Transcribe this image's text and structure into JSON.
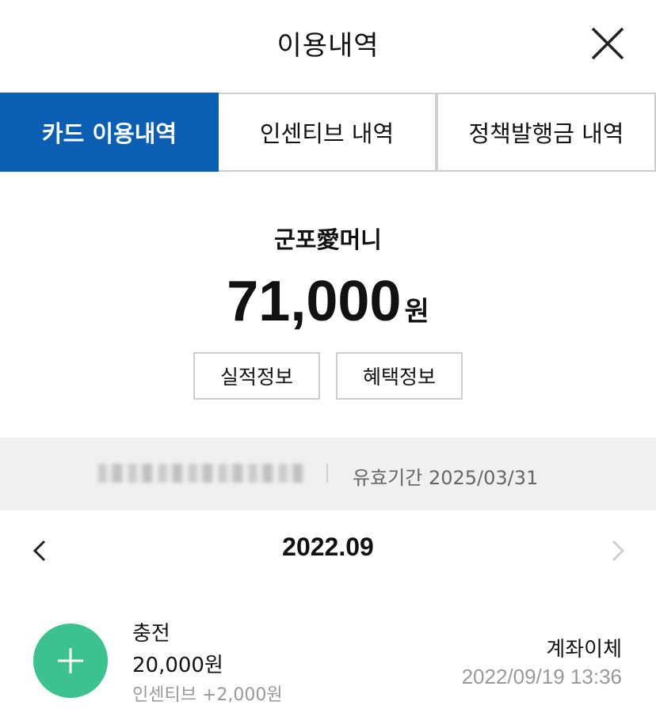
{
  "header": {
    "title": "이용내역",
    "close_icon": "close-icon"
  },
  "tabs": [
    {
      "label": "카드 이용내역",
      "active": true
    },
    {
      "label": "인센티브 내역",
      "active": false
    },
    {
      "label": "정책발행금 내역",
      "active": false
    }
  ],
  "summary": {
    "card_name": "군포愛머니",
    "balance": "71,000",
    "balance_unit": "원",
    "buttons": [
      {
        "label": "실적정보"
      },
      {
        "label": "혜택정보"
      }
    ]
  },
  "card_bar": {
    "validity": "유효기간 2025/03/31"
  },
  "month_nav": {
    "label": "2022.09",
    "prev_icon": "chevron-left-icon",
    "next_icon": "chevron-right-icon"
  },
  "transactions": [
    {
      "type": "충전",
      "amount": "20,000원",
      "incentive": "인센티브 +2,000원",
      "method": "계좌이체",
      "date": "2022/09/19 13:36",
      "icon": "plus-icon"
    }
  ],
  "colors": {
    "accent": "#0a5fb4",
    "charge_icon": "#3cc28e",
    "muted_text": "#999999"
  }
}
